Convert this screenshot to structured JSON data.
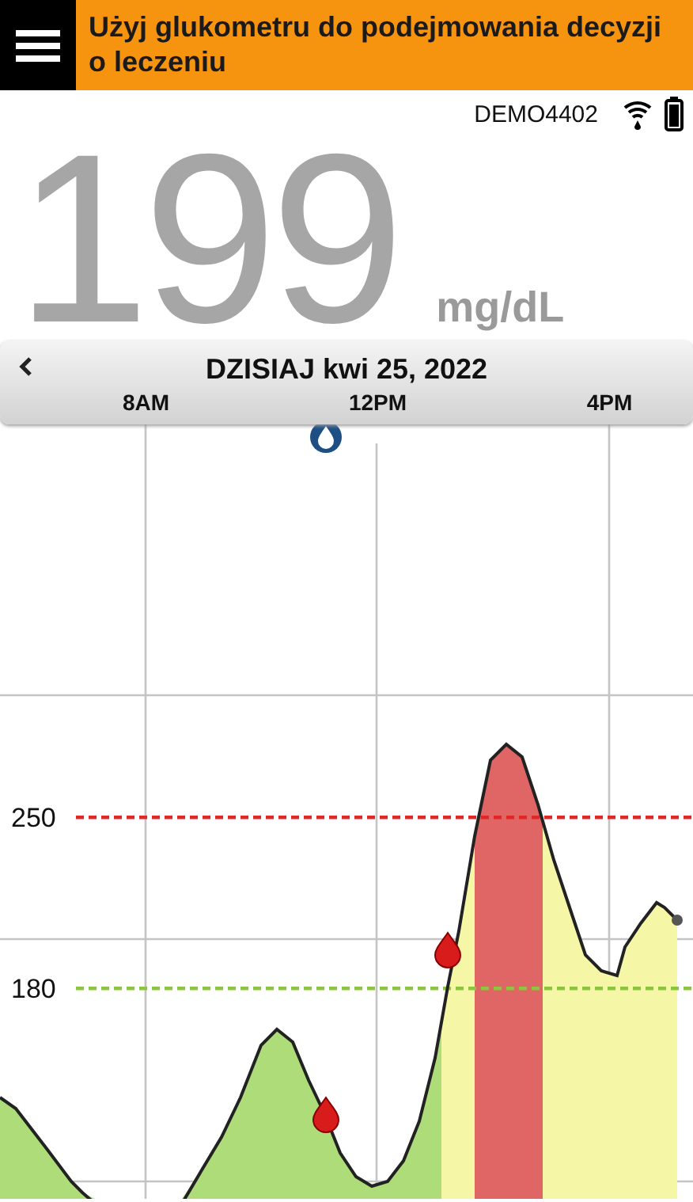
{
  "header": {
    "title": "Użyj glukometru do podejmowania decyzji o leczeniu"
  },
  "status": {
    "device": "DEMO4402"
  },
  "reading": {
    "value": "199",
    "unit": "mg/dL"
  },
  "date_bar": {
    "title": "DZISIAJ kwi 25, 2022",
    "time_labels": [
      "8AM",
      "12PM",
      "4PM"
    ]
  },
  "chart": {
    "thresholds": [
      {
        "label": "250",
        "color": "#e02828"
      },
      {
        "label": "180",
        "color": "#8cc63f"
      }
    ]
  }
}
